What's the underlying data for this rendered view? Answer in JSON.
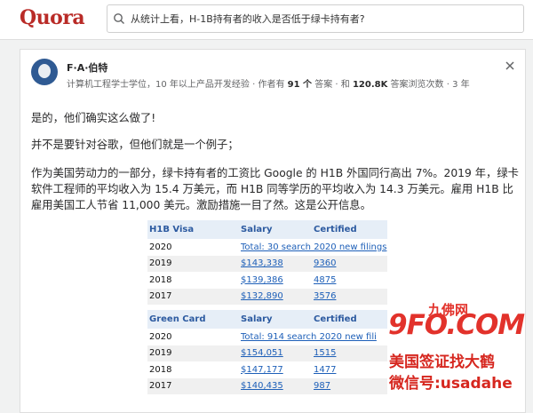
{
  "header": {
    "logo": "Quora",
    "search_query": "从统计上看，H-1B持有者的收入是否低于绿卡持有者?"
  },
  "answer": {
    "author": "F·A·伯特",
    "cred_prefix": "计算机工程学士学位，10 年以上产品开发经验 · 作者有",
    "answers_count": "91 个",
    "answers_word": "答案 · 和",
    "views_count": "120.8K",
    "views_word": "答案浏览次数 · 3 年",
    "paragraphs": [
      "是的，他们确实这么做了!",
      "并不是要针对谷歌，但他们就是一个例子；",
      "作为美国劳动力的一部分，绿卡持有者的工资比 Google 的 H1B 外国同行高出 7%。2019 年，绿卡软件工程师的平均收入为 15.4 万美元，而 H1B 同等学历的平均收入为 14.3 万美元。雇用 H1B 比雇用美国工人节省 11,000 美元。激励措施一目了然。这是公开信息。"
    ]
  },
  "table": {
    "h1b_header": [
      "H1B Visa",
      "Salary",
      "Certified"
    ],
    "h1b_rows": [
      [
        "2020",
        "Total: 30 search 2020 new filings",
        ""
      ],
      [
        "2019",
        "$143,338",
        "9360"
      ],
      [
        "2018",
        "$139,386",
        "4875"
      ],
      [
        "2017",
        "$132,890",
        "3576"
      ]
    ],
    "gc_header": [
      "Green Card",
      "Salary",
      "Certified"
    ],
    "gc_rows": [
      [
        "2020",
        "Total: 914 search 2020 new fili",
        ""
      ],
      [
        "2019",
        "$154,051",
        "1515"
      ],
      [
        "2018",
        "$147,177",
        "1477"
      ],
      [
        "2017",
        "$140,435",
        "987"
      ]
    ]
  },
  "watermark": {
    "top": "九佛网",
    "main": "9FO.COM",
    "line1": "美国签证找大鹤",
    "line2": "微信号:usadahe"
  },
  "colors": {
    "brand": "#b92b27",
    "link": "#1d5fb8",
    "watermark": "#e2322b"
  }
}
